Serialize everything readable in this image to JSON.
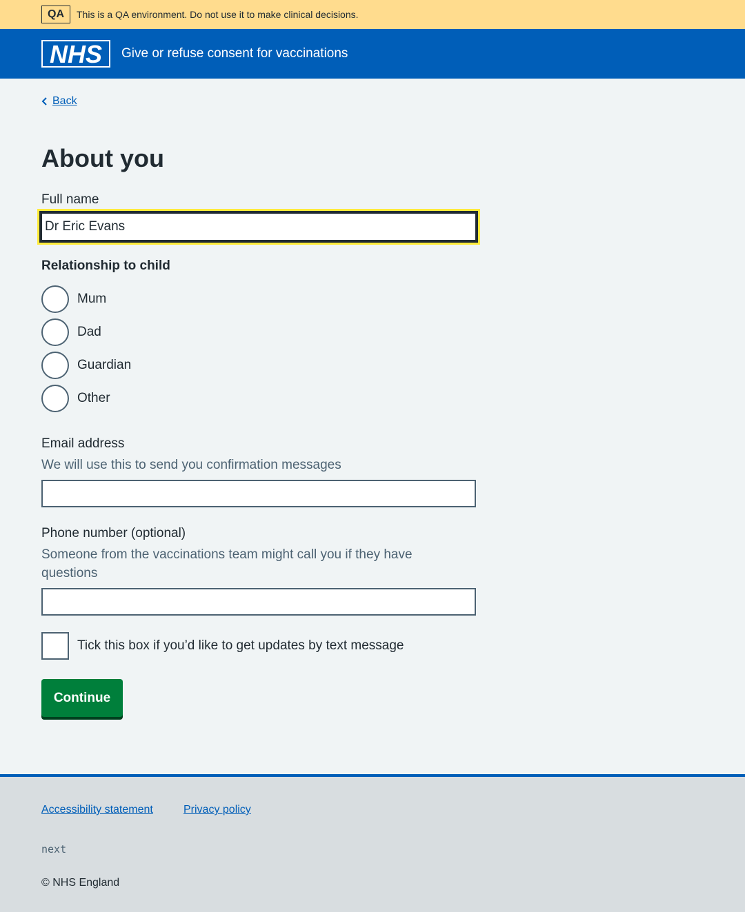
{
  "qa_banner": {
    "tag": "QA",
    "message": "This is a QA environment. Do not use it to make clinical decisions.",
    "background": "#ffdc8e"
  },
  "header": {
    "logo_text": "NHS",
    "service_name": "Give or refuse consent for vaccinations",
    "background": "#005eb8"
  },
  "nav": {
    "back_label": "Back"
  },
  "page": {
    "title": "About you"
  },
  "form": {
    "full_name": {
      "label": "Full name",
      "value": "Dr Eric Evans"
    },
    "relationship": {
      "legend": "Relationship to child",
      "options": [
        "Mum",
        "Dad",
        "Guardian",
        "Other"
      ]
    },
    "email": {
      "label": "Email address",
      "hint": "We will use this to send you confirmation messages",
      "value": ""
    },
    "phone": {
      "label": "Phone number (optional)",
      "hint": "Someone from the vaccinations team might call you if they have questions",
      "value": ""
    },
    "sms_checkbox": {
      "label": "Tick this box if you’d like to get updates by text message",
      "checked": false
    },
    "continue_label": "Continue"
  },
  "footer": {
    "links": [
      "Accessibility statement",
      "Privacy policy"
    ],
    "version": "next",
    "copyright": "© NHS England"
  },
  "colors": {
    "link": "#005eb8",
    "button": "#007f3b",
    "focus": "#ffeb3b",
    "page_background": "#f0f4f5"
  }
}
